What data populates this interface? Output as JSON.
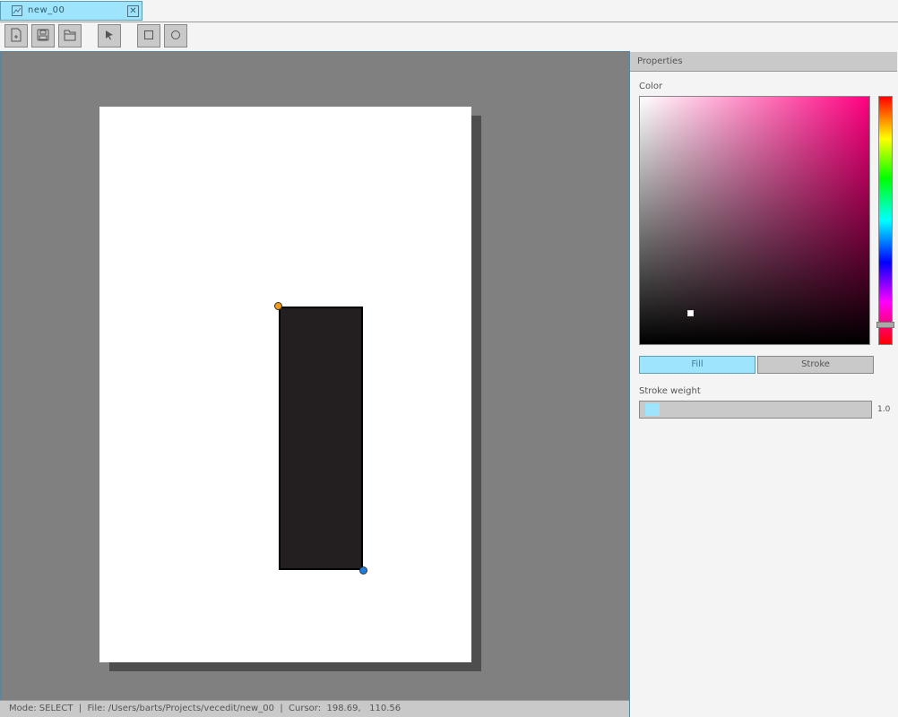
{
  "tab": {
    "title": "new_00",
    "icon": "image-icon",
    "close_glyph": "✕"
  },
  "toolbar": {
    "buttons": [
      {
        "name": "new-file-button",
        "icon": "new-file-icon"
      },
      {
        "name": "save-button",
        "icon": "save-icon"
      },
      {
        "name": "open-button",
        "icon": "open-icon"
      },
      {
        "name": "select-tool-button",
        "icon": "cursor-icon"
      },
      {
        "name": "rectangle-tool-button",
        "icon": "square-icon"
      },
      {
        "name": "ellipse-tool-button",
        "icon": "circle-icon"
      }
    ]
  },
  "canvas": {
    "shape": {
      "type": "rectangle",
      "fill": "#231f20",
      "stroke": "#000000"
    },
    "handle_colors": {
      "top_left": "#f39c12",
      "bottom_right": "#1e7ee0"
    }
  },
  "status": {
    "text": "Mode: SELECT  |  File: /Users/barts/Projects/vecedit/new_00  |  Cursor:  198.69,   110.56"
  },
  "properties": {
    "title": "Properties",
    "color_label": "Color",
    "fill_label": "Fill",
    "stroke_label": "Stroke",
    "stroke_weight_label": "Stroke weight",
    "stroke_weight_value": "1.0",
    "active_mode": "Fill"
  },
  "colors": {
    "accent": "#9ee4fd",
    "panel": "#c9c9c9",
    "canvas_bg": "#808080"
  }
}
